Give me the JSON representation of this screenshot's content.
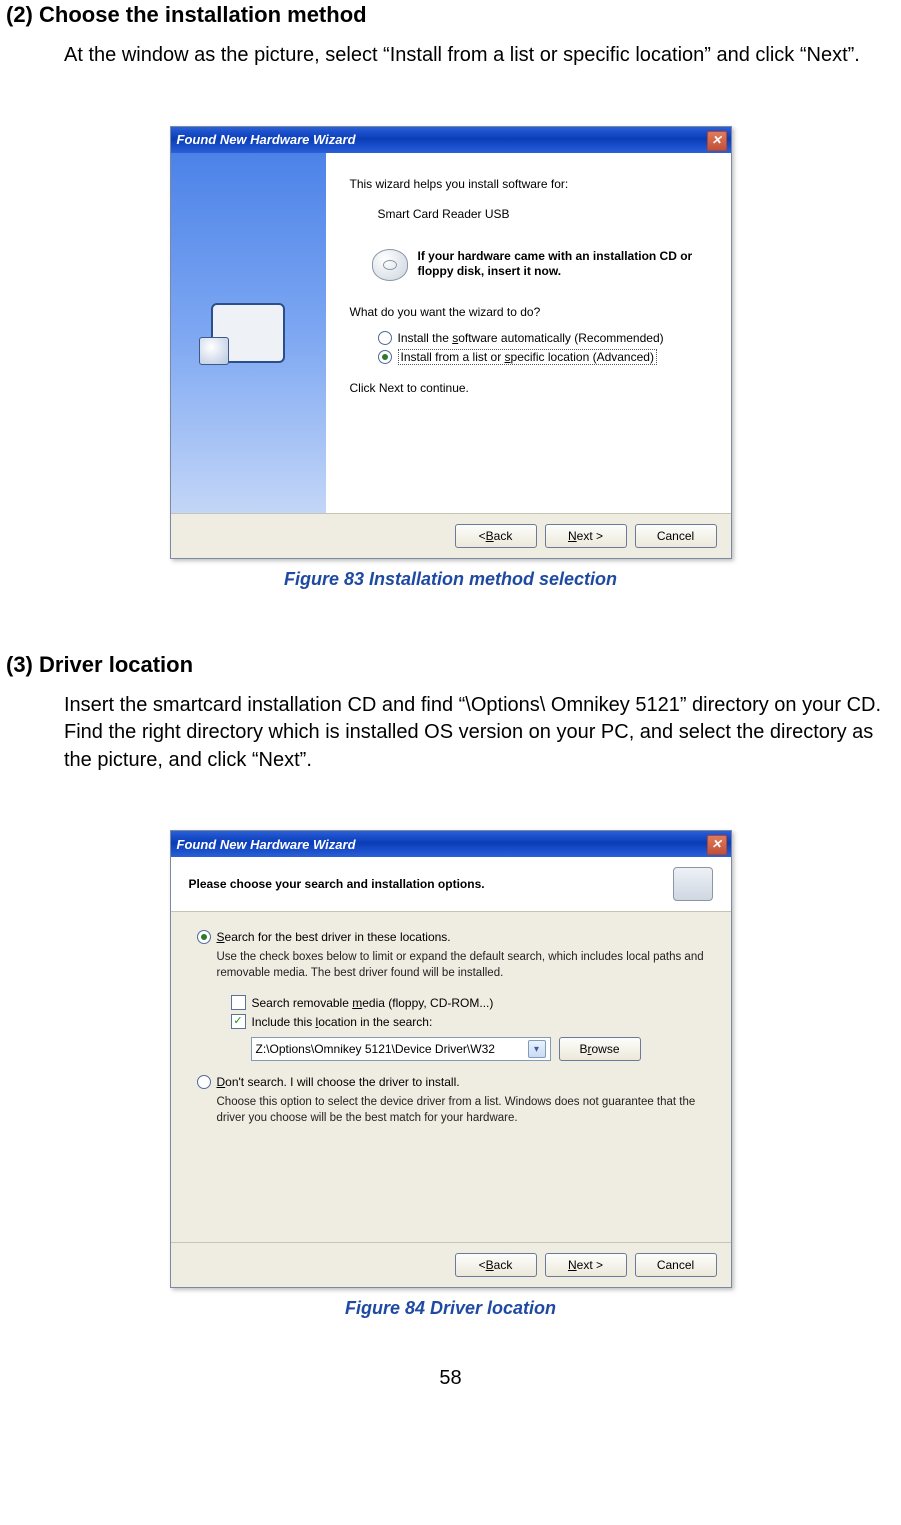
{
  "section2": {
    "heading": "(2) Choose the installation method",
    "paragraph": "At the window as the picture, select “Install from a list or specific location” and click “Next”."
  },
  "figure83": {
    "caption": "Figure 83 Installation method selection",
    "window_title": "Found New Hardware Wizard",
    "lead": "This wizard helps you install software for:",
    "device_name": "Smart Card Reader USB",
    "cd_text": "If your hardware came with an installation CD or floppy disk, insert it now.",
    "what": "What do you want the wizard to do?",
    "opt_auto_pre": "Install the ",
    "opt_auto_u": "s",
    "opt_auto_post": "oftware automatically (Recommended)",
    "opt_adv_pre": "Install from a list or ",
    "opt_adv_u": "s",
    "opt_adv_post": "pecific location (Advanced)",
    "click_next": "Click Next to continue.",
    "btn_back_pre": "< ",
    "btn_back_u": "B",
    "btn_back_post": "ack",
    "btn_next_u": "N",
    "btn_next_post": "ext >",
    "btn_cancel": "Cancel"
  },
  "section3": {
    "heading": "(3) Driver location",
    "paragraph": "Insert the smartcard installation CD and find “\\Options\\ Omnikey 5121” directory on your CD. Find the right directory which is installed OS version on your PC, and select the directory as the picture, and click “Next”."
  },
  "figure84": {
    "caption": "Figure 84 Driver location",
    "window_title": "Found New Hardware Wizard",
    "header": "Please choose your search and installation options.",
    "opt_search_u": "S",
    "opt_search_post": "earch for the best driver in these locations.",
    "note_search": "Use the check boxes below to limit or expand the default search, which includes local paths and removable media. The best driver found will be installed.",
    "chk_removable_pre": "Search removable ",
    "chk_removable_u": "m",
    "chk_removable_post": "edia (floppy, CD-ROM...)",
    "chk_include_pre": "Include this ",
    "chk_include_u": "l",
    "chk_include_post": "ocation in the search:",
    "path_value": "Z:\\Options\\Omnikey 5121\\Device Driver\\W32",
    "btn_browse_u": "r",
    "btn_browse_pre": "B",
    "btn_browse_post": "owse",
    "opt_dont_u": "D",
    "opt_dont_post": "on't search. I will choose the driver to install.",
    "note_dont": "Choose this option to select the device driver from a list.  Windows does not guarantee that the driver you choose will be the best match for your hardware.",
    "btn_back_pre": "< ",
    "btn_back_u": "B",
    "btn_back_post": "ack",
    "btn_next_u": "N",
    "btn_next_post": "ext >",
    "btn_cancel": "Cancel"
  },
  "page_number": "58"
}
